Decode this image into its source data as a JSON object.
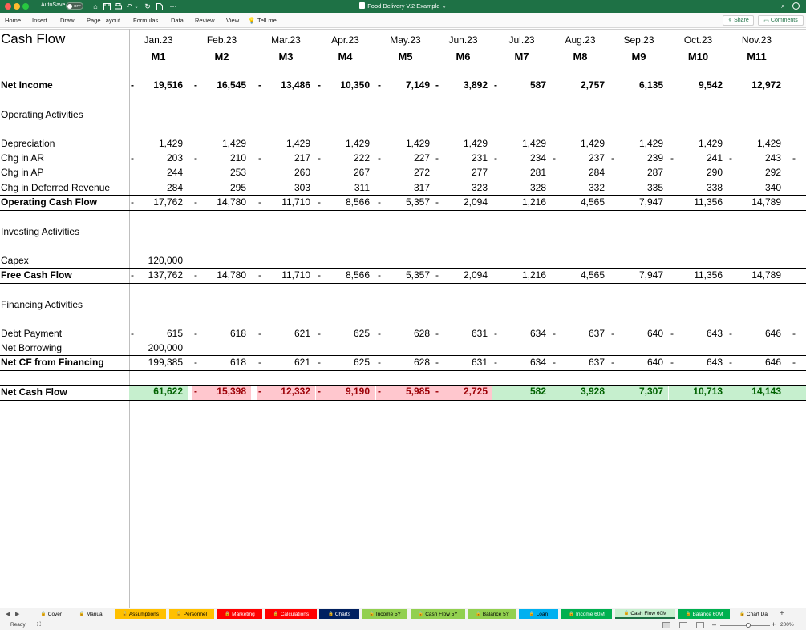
{
  "titlebar": {
    "autosave_label": "AutoSave",
    "autosave_state": "OFF",
    "doc_title": "Food Delivery V.2 Example",
    "caret": "⌄"
  },
  "ribbon": {
    "menus": [
      "Home",
      "Insert",
      "Draw",
      "Page Layout",
      "Formulas",
      "Data",
      "Review",
      "View",
      "Tell me"
    ],
    "share": "Share",
    "comments": "Comments"
  },
  "sheet": {
    "title": "Cash Flow",
    "months": [
      "Jan.23",
      "Feb.23",
      "Mar.23",
      "Apr.23",
      "May.23",
      "Jun.23",
      "Jul.23",
      "Aug.23",
      "Sep.23",
      "Oct.23",
      "Nov.23"
    ],
    "periods": [
      "M1",
      "M2",
      "M3",
      "M4",
      "M5",
      "M6",
      "M7",
      "M8",
      "M9",
      "M10",
      "M11"
    ],
    "rows": [
      {
        "key": "net-income",
        "label": "Net Income",
        "style": "bold",
        "cells": [
          [
            "-",
            "19,516"
          ],
          [
            "-",
            "16,545"
          ],
          [
            "-",
            "13,486"
          ],
          [
            "-",
            "10,350"
          ],
          [
            "-",
            "7,149"
          ],
          [
            "-",
            "3,892"
          ],
          [
            "-",
            "587"
          ],
          [
            "",
            "2,757"
          ],
          [
            "",
            "6,135"
          ],
          [
            "",
            "9,542"
          ],
          [
            "",
            "12,972"
          ]
        ]
      },
      {
        "key": "operating-activities",
        "label": "Operating Activities",
        "style": "section",
        "cells": []
      },
      {
        "key": "depreciation",
        "label": "Depreciation",
        "style": "normal",
        "cells": [
          [
            "",
            "1,429"
          ],
          [
            "",
            "1,429"
          ],
          [
            "",
            "1,429"
          ],
          [
            "",
            "1,429"
          ],
          [
            "",
            "1,429"
          ],
          [
            "",
            "1,429"
          ],
          [
            "",
            "1,429"
          ],
          [
            "",
            "1,429"
          ],
          [
            "",
            "1,429"
          ],
          [
            "",
            "1,429"
          ],
          [
            "",
            "1,429"
          ]
        ]
      },
      {
        "key": "chg-in-ar",
        "label": "Chg in AR",
        "style": "normal",
        "cells": [
          [
            "-",
            "203"
          ],
          [
            "-",
            "210"
          ],
          [
            "-",
            "217"
          ],
          [
            "-",
            "222"
          ],
          [
            "-",
            "227"
          ],
          [
            "-",
            "231"
          ],
          [
            "-",
            "234"
          ],
          [
            "-",
            "237"
          ],
          [
            "-",
            "239"
          ],
          [
            "-",
            "241"
          ],
          [
            "-",
            "243"
          ]
        ],
        "tail": "-"
      },
      {
        "key": "chg-in-ap",
        "label": "Chg in AP",
        "style": "normal",
        "cells": [
          [
            "",
            "244"
          ],
          [
            "",
            "253"
          ],
          [
            "",
            "260"
          ],
          [
            "",
            "267"
          ],
          [
            "",
            "272"
          ],
          [
            "",
            "277"
          ],
          [
            "",
            "281"
          ],
          [
            "",
            "284"
          ],
          [
            "",
            "287"
          ],
          [
            "",
            "290"
          ],
          [
            "",
            "292"
          ]
        ]
      },
      {
        "key": "chg-in-deferred-revenue",
        "label": "Chg in Deferred Revenue",
        "style": "normal",
        "cells": [
          [
            "",
            "284"
          ],
          [
            "",
            "295"
          ],
          [
            "",
            "303"
          ],
          [
            "",
            "311"
          ],
          [
            "",
            "317"
          ],
          [
            "",
            "323"
          ],
          [
            "",
            "328"
          ],
          [
            "",
            "332"
          ],
          [
            "",
            "335"
          ],
          [
            "",
            "338"
          ],
          [
            "",
            "340"
          ]
        ]
      },
      {
        "key": "operating-cash-flow",
        "label": "Operating Cash Flow",
        "style": "total",
        "cells": [
          [
            "-",
            "17,762"
          ],
          [
            "-",
            "14,780"
          ],
          [
            "-",
            "11,710"
          ],
          [
            "-",
            "8,566"
          ],
          [
            "-",
            "5,357"
          ],
          [
            "-",
            "2,094"
          ],
          [
            "",
            "1,216"
          ],
          [
            "",
            "4,565"
          ],
          [
            "",
            "7,947"
          ],
          [
            "",
            "11,356"
          ],
          [
            "",
            "14,789"
          ]
        ]
      },
      {
        "key": "investing-activities",
        "label": "Investing Activities",
        "style": "section",
        "cells": []
      },
      {
        "key": "capex",
        "label": "Capex",
        "style": "normal",
        "cells": [
          [
            "",
            "120,000"
          ]
        ]
      },
      {
        "key": "free-cash-flow",
        "label": "Free Cash Flow",
        "style": "total",
        "cells": [
          [
            "-",
            "137,762"
          ],
          [
            "-",
            "14,780"
          ],
          [
            "-",
            "11,710"
          ],
          [
            "-",
            "8,566"
          ],
          [
            "-",
            "5,357"
          ],
          [
            "-",
            "2,094"
          ],
          [
            "",
            "1,216"
          ],
          [
            "",
            "4,565"
          ],
          [
            "",
            "7,947"
          ],
          [
            "",
            "11,356"
          ],
          [
            "",
            "14,789"
          ]
        ]
      },
      {
        "key": "financing-activities",
        "label": "Financing Activities",
        "style": "section",
        "cells": []
      },
      {
        "key": "debt-payment",
        "label": "Debt Payment",
        "style": "normal",
        "cells": [
          [
            "-",
            "615"
          ],
          [
            "-",
            "618"
          ],
          [
            "-",
            "621"
          ],
          [
            "-",
            "625"
          ],
          [
            "-",
            "628"
          ],
          [
            "-",
            "631"
          ],
          [
            "-",
            "634"
          ],
          [
            "-",
            "637"
          ],
          [
            "-",
            "640"
          ],
          [
            "-",
            "643"
          ],
          [
            "-",
            "646"
          ]
        ],
        "tail": "-"
      },
      {
        "key": "net-borrowing",
        "label": "Net Borrowing",
        "style": "normal",
        "cells": [
          [
            "",
            "200,000"
          ]
        ]
      },
      {
        "key": "net-cf-from-financing",
        "label": "Net CF from Financing",
        "style": "total",
        "cells": [
          [
            "",
            "199,385"
          ],
          [
            "-",
            "618"
          ],
          [
            "-",
            "621"
          ],
          [
            "-",
            "625"
          ],
          [
            "-",
            "628"
          ],
          [
            "-",
            "631"
          ],
          [
            "-",
            "634"
          ],
          [
            "-",
            "637"
          ],
          [
            "-",
            "640"
          ],
          [
            "-",
            "643"
          ],
          [
            "-",
            "646"
          ]
        ],
        "tail": "-"
      },
      {
        "key": "net-cash-flow",
        "label": "Net Cash Flow",
        "style": "highlight",
        "cells": [
          [
            "",
            "61,622"
          ],
          [
            "-",
            "15,398"
          ],
          [
            "-",
            "12,332"
          ],
          [
            "-",
            "9,190"
          ],
          [
            "-",
            "5,985"
          ],
          [
            "-",
            "2,725"
          ],
          [
            "",
            "582"
          ],
          [
            "",
            "3,928"
          ],
          [
            "",
            "7,307"
          ],
          [
            "",
            "10,713"
          ],
          [
            "",
            "14,143"
          ]
        ]
      }
    ]
  },
  "colors": {
    "excel_green": "#1e7145",
    "positive_fill": "#c6efce",
    "positive_text": "#006100",
    "negative_fill": "#ffc7ce",
    "negative_text": "#9c0006"
  },
  "tabs": [
    {
      "label": "Cover",
      "bg": "#f3f3f3",
      "fg": "#000000"
    },
    {
      "label": "Manual",
      "bg": "#f3f3f3",
      "fg": "#000000"
    },
    {
      "label": "Assumptions",
      "bg": "#ffc000",
      "fg": "#000000"
    },
    {
      "label": "Personnel",
      "bg": "#ffc000",
      "fg": "#000000"
    },
    {
      "label": "Marketing",
      "bg": "#ff0000",
      "fg": "#ffffff"
    },
    {
      "label": "Calculations",
      "bg": "#ff0000",
      "fg": "#ffffff"
    },
    {
      "label": "Charts",
      "bg": "#002060",
      "fg": "#ffffff"
    },
    {
      "label": "Income 5Y",
      "bg": "#92d050",
      "fg": "#000000"
    },
    {
      "label": "Cash Flow 5Y",
      "bg": "#92d050",
      "fg": "#000000"
    },
    {
      "label": "Balance 5Y",
      "bg": "#92d050",
      "fg": "#000000"
    },
    {
      "label": "Loan",
      "bg": "#00b0f0",
      "fg": "#000000"
    },
    {
      "label": "Income 60M",
      "bg": "#00b050",
      "fg": "#ffffff"
    },
    {
      "label": "Cash Flow 60M",
      "bg": "#c6efce",
      "fg": "#000000"
    },
    {
      "label": "Balance 60M",
      "bg": "#00b050",
      "fg": "#ffffff"
    },
    {
      "label": "Chart Da",
      "bg": "#f3f3f3",
      "fg": "#000000"
    }
  ],
  "tab_nav": {
    "prev": "◀",
    "next": "▶",
    "add": "+",
    "lock": "🔒"
  },
  "status": {
    "ready": "Ready",
    "zoom_minus": "–",
    "zoom_plus": "+",
    "zoom": "200%"
  }
}
